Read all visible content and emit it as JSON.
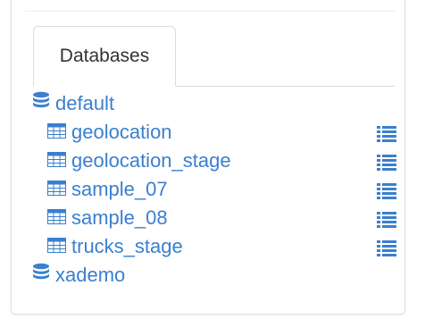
{
  "tabs": [
    {
      "label": "Databases"
    }
  ],
  "colors": {
    "link": "#3a7fd0",
    "tab_text": "#333333",
    "border": "#dcdcdc"
  },
  "databases": [
    {
      "name": "default",
      "icon": "database-icon",
      "tables": [
        {
          "name": "geolocation",
          "icon": "table-icon",
          "action_icon": "list-icon"
        },
        {
          "name": "geolocation_stage",
          "icon": "table-icon",
          "action_icon": "list-icon"
        },
        {
          "name": "sample_07",
          "icon": "table-icon",
          "action_icon": "list-icon"
        },
        {
          "name": "sample_08",
          "icon": "table-icon",
          "action_icon": "list-icon"
        },
        {
          "name": "trucks_stage",
          "icon": "table-icon",
          "action_icon": "list-icon"
        }
      ]
    },
    {
      "name": "xademo",
      "icon": "database-icon",
      "tables": []
    }
  ]
}
